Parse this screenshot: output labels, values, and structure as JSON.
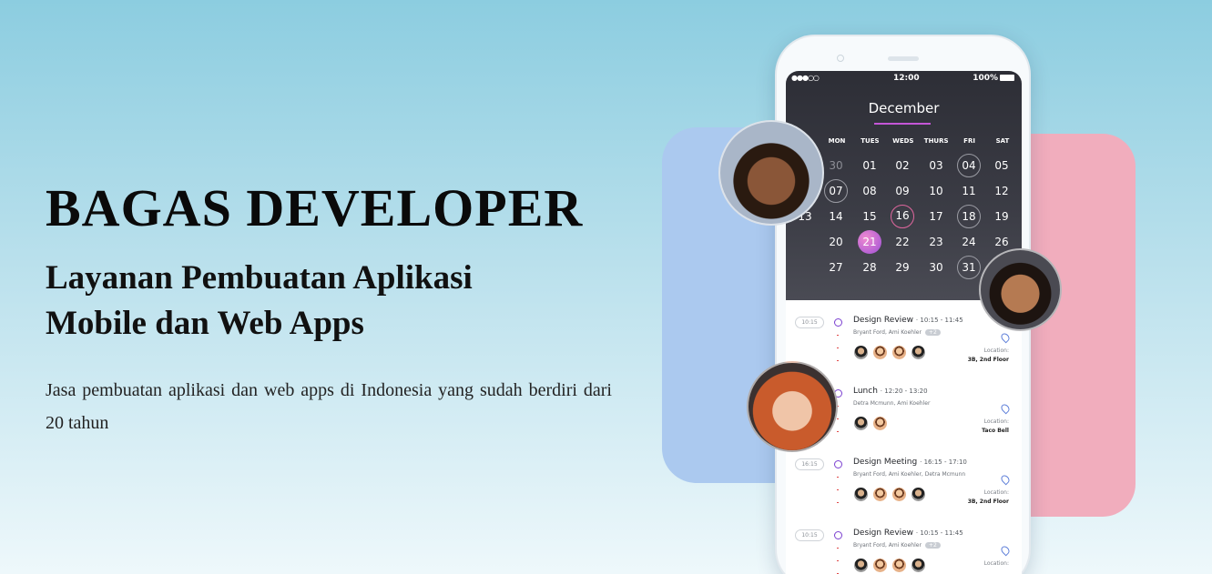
{
  "hero": {
    "title": "BAGAS DEVELOPER",
    "subtitle": "Layanan Pembuatan Aplikasi Mobile dan Web Apps",
    "description": "Jasa pembuatan aplikasi dan web apps di Indonesia yang sudah berdiri dari 20 tahun"
  },
  "phone": {
    "status": {
      "signal": "●●●○○",
      "time": "12:00",
      "battery": "100%"
    },
    "month": "December",
    "weekdays": [
      "MON",
      "TUES",
      "WEDS",
      "THURS",
      "FRI",
      "SAT"
    ],
    "days": [
      [
        "30",
        "01",
        "02",
        "03",
        "04",
        "05"
      ],
      [
        "07",
        "08",
        "09",
        "10",
        "11",
        "12"
      ],
      [
        "14",
        "15",
        "16",
        "17",
        "18",
        "19"
      ],
      [
        "20",
        "21",
        "22",
        "23",
        "24",
        "26"
      ],
      [
        "27",
        "28",
        "29",
        "30",
        "31",
        "01"
      ]
    ],
    "partial_day": "13",
    "events": [
      {
        "time": "10:15",
        "title": "Design Review",
        "span": "10:15 - 11:45",
        "people": "Bryant Ford, Ami Koehler",
        "more": "+2",
        "location_label": "Location:",
        "location": "3B, 2nd Floor"
      },
      {
        "time": "",
        "title": "Lunch",
        "span": "12:20 - 13:20",
        "people": "Detra Mcmunn, Ami Koehler",
        "more": "",
        "location_label": "Location:",
        "location": "Taco Bell"
      },
      {
        "time": "16:15",
        "title": "Design Meeting",
        "span": "16:15 - 17:10",
        "people": "Bryant Ford, Ami Koehler, Detra Mcmunn",
        "more": "",
        "location_label": "Location:",
        "location": "3B, 2nd Floor"
      },
      {
        "time": "10:15",
        "title": "Design Review",
        "span": "10:15 - 11:45",
        "people": "Bryant Ford, Ami Koehler",
        "more": "+2",
        "location_label": "Location:",
        "location": ""
      }
    ]
  },
  "colors": {
    "accent": "#c456d6",
    "blue_card": "#abc9ef",
    "pink_card": "#f1adbd"
  }
}
